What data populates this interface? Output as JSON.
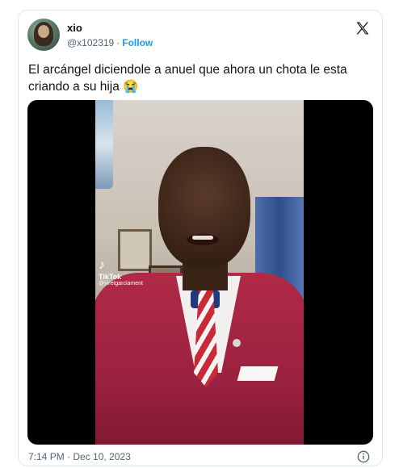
{
  "tweet": {
    "author_name": "xio",
    "author_handle": "@x102319",
    "separator": "·",
    "follow_label": "Follow",
    "text": "El arcángel diciendole a anuel que ahora un chota le esta criando a su hija 😭",
    "timestamp": "7:14 PM · Dec 10, 2023"
  },
  "media": {
    "watermark_brand": "TikTok",
    "watermark_user": "@yiretgarciament"
  },
  "icons": {
    "platform_logo": "x-logo-icon",
    "info": "info-icon",
    "tiktok": "tiktok-note-icon"
  },
  "colors": {
    "accent": "#1d9bf0",
    "secondary_text": "#536471",
    "border": "#e1e8ed"
  }
}
